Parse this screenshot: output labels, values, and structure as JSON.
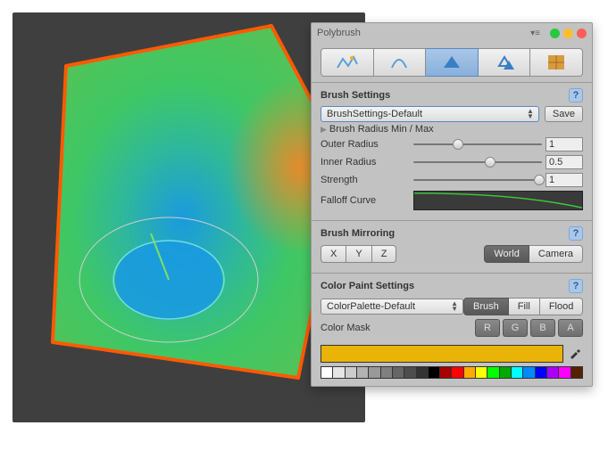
{
  "window": {
    "title": "Polybrush"
  },
  "toolbar": {
    "icons": [
      "sculpt-icon",
      "smooth-icon",
      "color-icon",
      "prefab-icon",
      "texture-icon"
    ],
    "active_index": 2
  },
  "brush_settings": {
    "heading": "Brush Settings",
    "preset": "BrushSettings-Default",
    "save_label": "Save",
    "radius_foldout": "Brush Radius Min / Max",
    "outer_radius": {
      "label": "Outer Radius",
      "value": "1",
      "pos": 0.35
    },
    "inner_radius": {
      "label": "Inner Radius",
      "value": "0.5",
      "pos": 0.6
    },
    "strength": {
      "label": "Strength",
      "value": "1",
      "pos": 0.98
    },
    "falloff_label": "Falloff Curve"
  },
  "mirroring": {
    "heading": "Brush Mirroring",
    "axes": [
      "X",
      "Y",
      "Z"
    ],
    "space": {
      "options": [
        "World",
        "Camera"
      ],
      "selected": 0
    }
  },
  "color_paint": {
    "heading": "Color Paint Settings",
    "palette_preset": "ColorPalette-Default",
    "modes": [
      "Brush",
      "Fill",
      "Flood"
    ],
    "mode_selected": 0,
    "mask_label": "Color Mask",
    "mask_channels": [
      "R",
      "G",
      "B",
      "A"
    ],
    "current_color": "#eab308",
    "swatches": [
      "#ffffff",
      "#e5e5e5",
      "#cccccc",
      "#b3b3b3",
      "#999999",
      "#808080",
      "#666666",
      "#4d4d4d",
      "#333333",
      "#000000",
      "#aa0000",
      "#ff0000",
      "#ffaa00",
      "#ffff00",
      "#00ff00",
      "#00aa00",
      "#00ffff",
      "#0088ff",
      "#0000ff",
      "#aa00ff",
      "#ff00ff",
      "#552200"
    ]
  },
  "chart_data": {
    "type": "line",
    "title": "Falloff Curve",
    "x": [
      0,
      1
    ],
    "xlim": [
      0,
      1
    ],
    "ylim": [
      0,
      1
    ],
    "series": [
      {
        "name": "falloff",
        "values": [
          1.0,
          0.0
        ]
      }
    ],
    "note": "Smooth ease-out curve from 1 at x=0 to 0 at x=1"
  }
}
